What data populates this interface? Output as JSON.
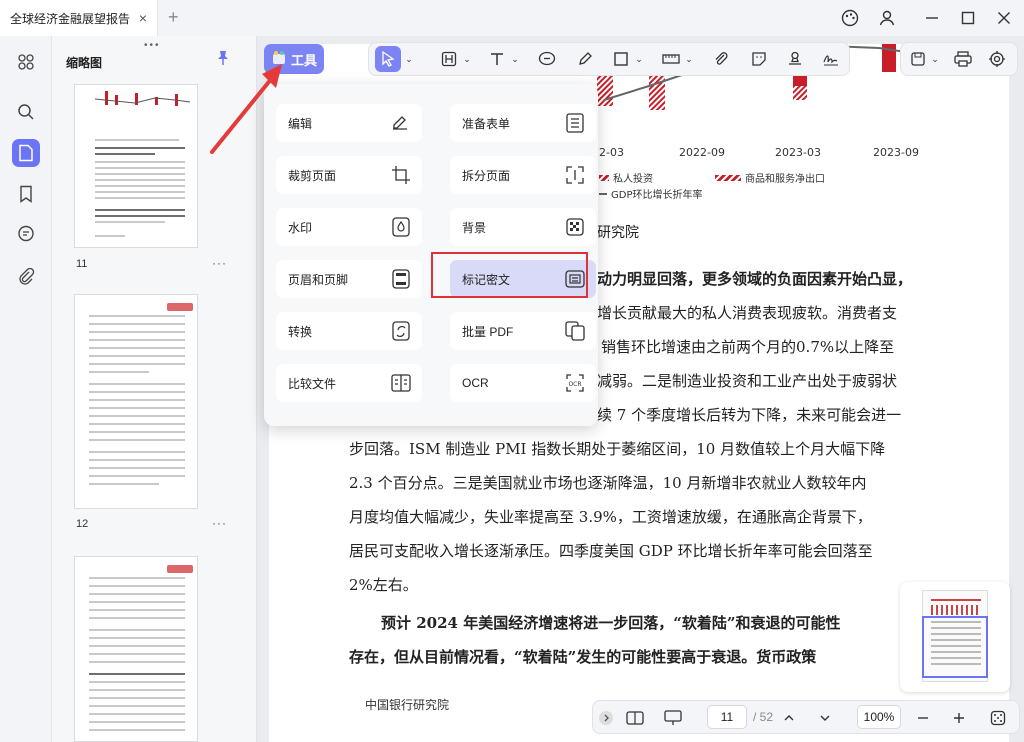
{
  "window": {
    "tab_title": "全球经济金融展望报告",
    "tab_close": "×",
    "new_tab": "+"
  },
  "thumbnails": {
    "title": "缩略图",
    "pages": [
      {
        "label": "11"
      },
      {
        "label": "12"
      }
    ],
    "more": "···"
  },
  "tool_button": {
    "label": "工具"
  },
  "tools_menu": {
    "items": [
      {
        "label": "编辑",
        "icon": "edit-icon"
      },
      {
        "label": "准备表单",
        "icon": "form-icon"
      },
      {
        "label": "裁剪页面",
        "icon": "crop-icon"
      },
      {
        "label": "拆分页面",
        "icon": "split-icon"
      },
      {
        "label": "水印",
        "icon": "watermark-icon"
      },
      {
        "label": "背景",
        "icon": "background-icon"
      },
      {
        "label": "页眉和页脚",
        "icon": "header-footer-icon"
      },
      {
        "label": "标记密文",
        "icon": "redact-icon"
      },
      {
        "label": "转换",
        "icon": "convert-icon"
      },
      {
        "label": "批量 PDF",
        "icon": "batch-icon"
      },
      {
        "label": "比较文件",
        "icon": "compare-icon"
      },
      {
        "label": "OCR",
        "icon": "ocr-icon"
      }
    ],
    "selected": "标记密文"
  },
  "document": {
    "chart_axis": [
      "2-03",
      "2022-09",
      "2023-03",
      "2023-09"
    ],
    "legend": [
      "私人投资",
      "商品和服务净出口",
      "GDP环比增长折年率"
    ],
    "source_suffix": "研究院",
    "lines": [
      {
        "text": "动力明显回落，更多领域的负面因素开始凸显，",
        "bold": true,
        "indent": 248
      },
      {
        "text": "增长贡献最大的私人消费表现疲软。消费者支",
        "bold": false,
        "indent": 248
      },
      {
        "text": "销售环比增速由之前两个月的0.7%以上降至",
        "bold": false,
        "indent": 252
      },
      {
        "text": "减弱。二是制造业投资和工业产出处于疲弱状",
        "bold": false,
        "indent": 248
      },
      {
        "text": "续 7 个季度增长后转为下降，未来可能会进一",
        "bold": false,
        "indent": 248
      },
      {
        "text": "步回落。ISM 制造业 PMI 指数长期处于萎缩区间，10 月数值较上个月大幅下降",
        "bold": false,
        "indent": 0
      },
      {
        "text": "2.3 个百分点。三是美国就业市场也逐渐降温，10 月新增非农就业人数较年内",
        "bold": false,
        "indent": 0
      },
      {
        "text": "月度均值大幅减少，失业率提高至 3.9%，工资增速放缓，在通胀高企背景下，",
        "bold": false,
        "indent": 0
      },
      {
        "text": "居民可支配收入增长逐渐承压。四季度美国 GDP 环比增长折年率可能会回落至",
        "bold": false,
        "indent": 0
      },
      {
        "text": "2%左右。",
        "bold": false,
        "indent": 0
      },
      {
        "text": "预计 2024 年美国经济增速将进一步回落，“软着陆”和衰退的可能性",
        "bold": true,
        "indent": 32
      },
      {
        "text": "存在，但从目前情况看，“软着陆”发生的可能性要高于衰退。货币政策",
        "bold": true,
        "indent": 0
      }
    ],
    "footer": "中国银行研究院"
  },
  "pagination": {
    "current": "11",
    "total": "/ 52",
    "zoom": "100%"
  },
  "colors": {
    "accent": "#7c83f3",
    "highlight": "#e0303a",
    "chart_red": "#c81e2a"
  }
}
